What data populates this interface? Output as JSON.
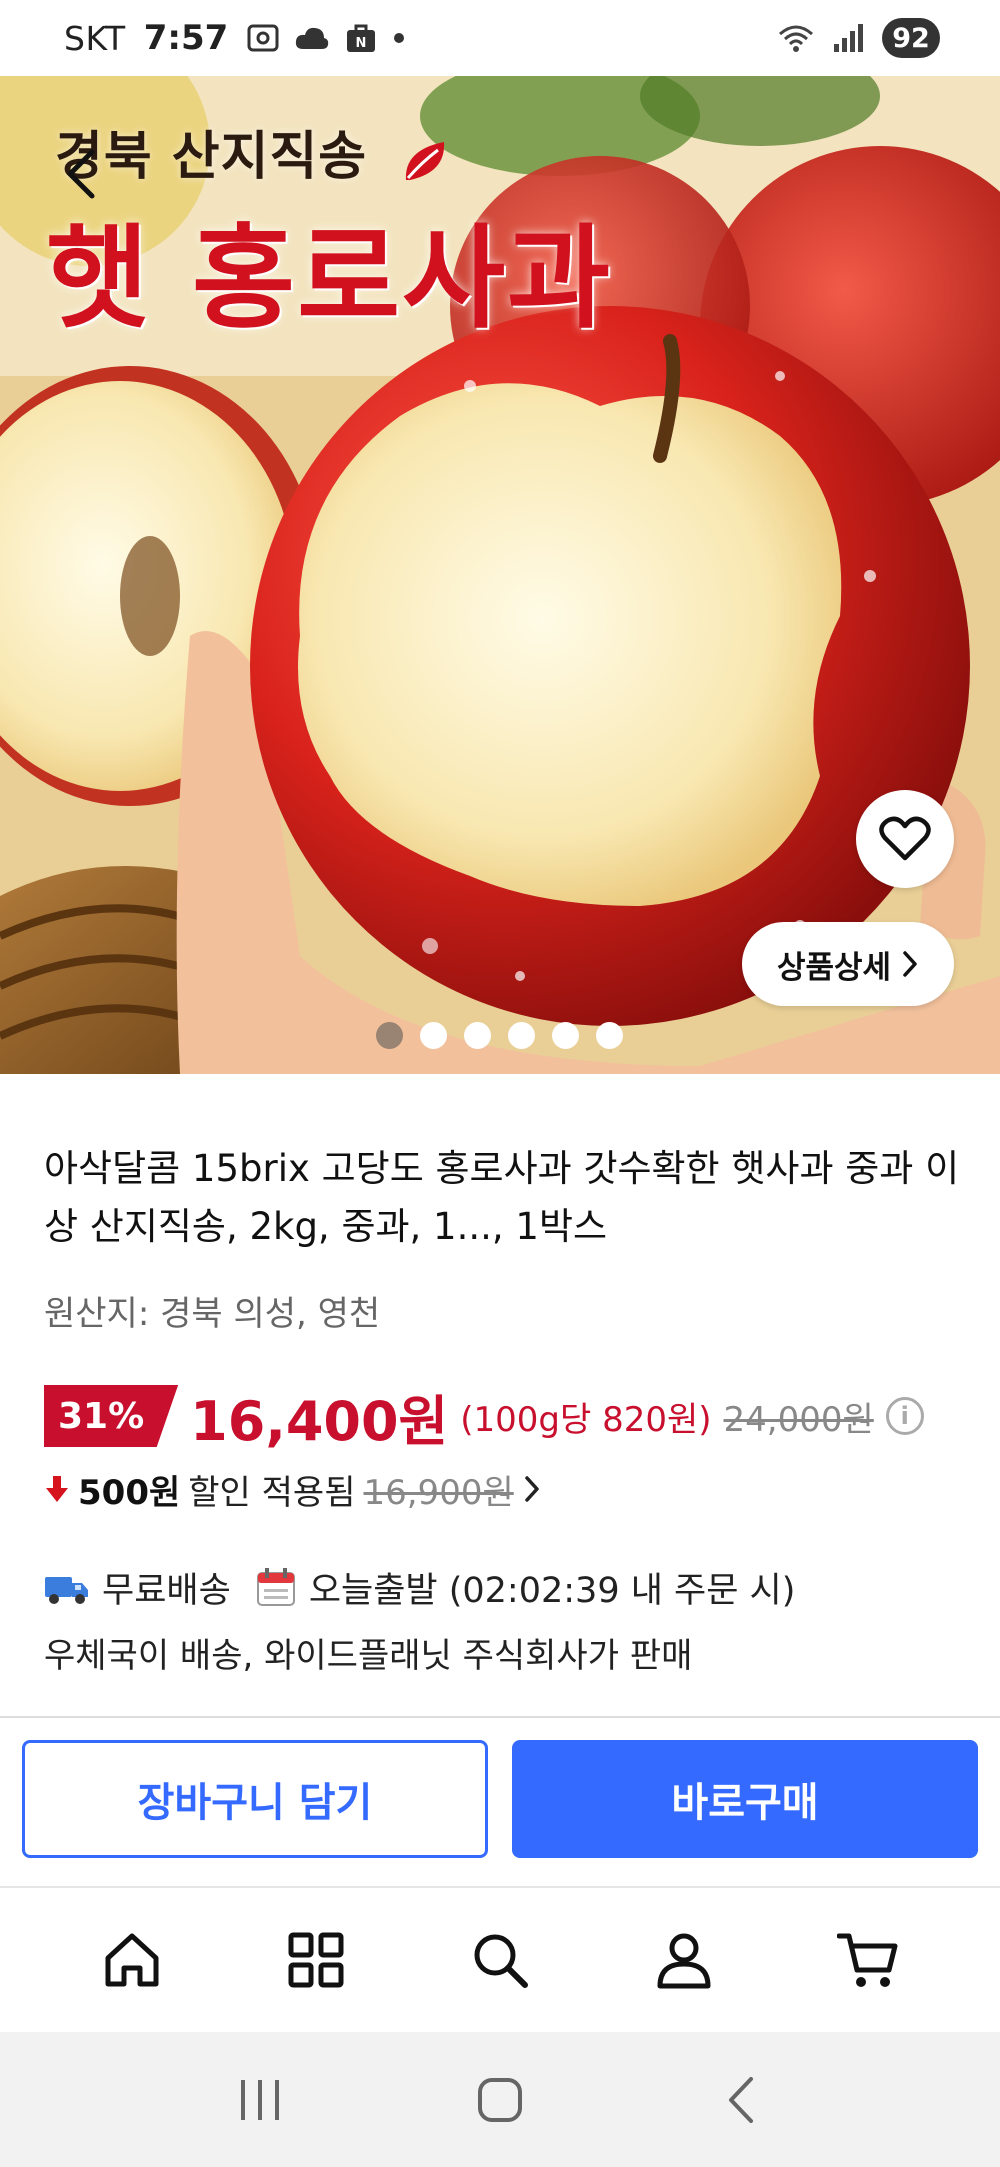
{
  "status_bar": {
    "carrier": "SKT",
    "time": "7:57",
    "battery": "92"
  },
  "hero": {
    "title_small": "경북 산지직송",
    "title_big": "햇 홍로사과",
    "detail_button_label": "상품상세",
    "image_count": 6,
    "active_image_index": 0
  },
  "product": {
    "title": "아삭달콤 15brix 고당도 홍로사과 갓수확한 햇사과 중과 이상 산지직송, 2kg, 중과, 1..., 1박스",
    "origin": "원산지: 경북 의성, 영천",
    "discount": "31%",
    "price": "16,400원",
    "unit_price": "(100g당 820원)",
    "original_price": "24,000원",
    "coupon_amount": "500원",
    "coupon_label": "할인 적용됨",
    "coupon_previous_price": "16,900원",
    "shipping": "무료배송",
    "dispatch": "오늘출발 (02:02:39 내 주문 시)",
    "seller": "우체국이 배송, 와이드플래닛 주식회사가 판매"
  },
  "actions": {
    "cart_label": "장바구니 담기",
    "buy_label": "바로구매"
  },
  "colors": {
    "accent_blue": "#346aff",
    "sale_red": "#c8102e"
  }
}
